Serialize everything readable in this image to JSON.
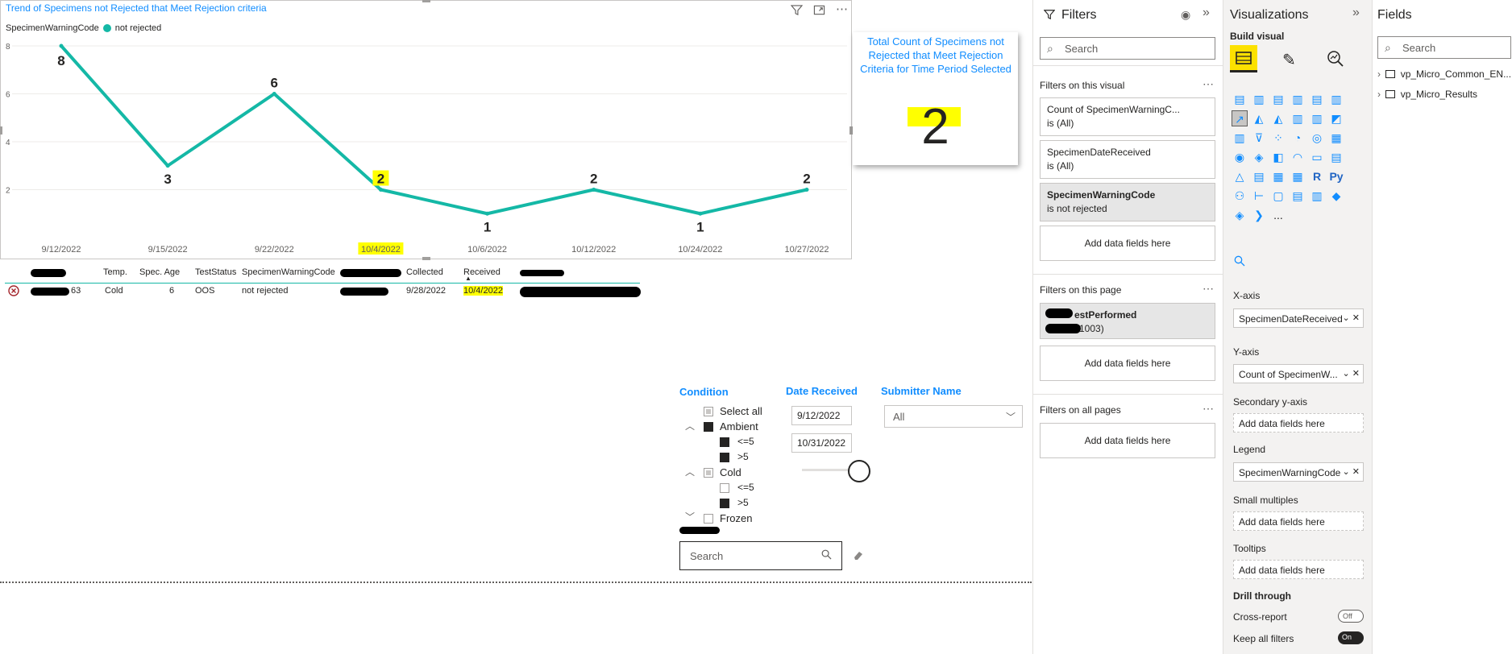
{
  "chart": {
    "title": "Trend of Specimens not Rejected that Meet Rejection criteria",
    "legend_title": "SpecimenWarningCode",
    "legend_item": "not rejected",
    "line_color": "#14b8a6",
    "y_ticks": [
      "8",
      "6",
      "4",
      "2"
    ],
    "icons": [
      "filter-icon",
      "focus-mode-icon",
      "more-options-icon"
    ]
  },
  "chart_data": {
    "type": "line",
    "categories": [
      "9/12/2022",
      "9/15/2022",
      "9/22/2022",
      "10/4/2022",
      "10/6/2022",
      "10/12/2022",
      "10/24/2022",
      "10/27/2022"
    ],
    "series": [
      {
        "name": "not rejected",
        "values": [
          8,
          3,
          6,
          2,
          1,
          2,
          1,
          2
        ]
      }
    ],
    "title": "Trend of Specimens not Rejected that Meet Rejection criteria",
    "ylim": [
      0,
      8
    ],
    "highlighted_category": "10/4/2022",
    "legend": "top-left",
    "grid": true
  },
  "card": {
    "label": "Total Count of Specimens not Rejected that Meet Rejection Criteria for Time Period Selected",
    "value": "2"
  },
  "table": {
    "headers": {
      "temp": "Temp.",
      "spec_age": "Spec. Age",
      "test_status": "TestStatus",
      "warning": "SpecimenWarningCode",
      "collected": "Collected",
      "received": "Received"
    },
    "row": {
      "id_suffix": "63",
      "temp": "Cold",
      "spec_age": "6",
      "test_status": "OOS",
      "warning": "not rejected",
      "collected": "9/28/2022",
      "received": "10/4/2022"
    }
  },
  "slicers": {
    "condition": {
      "title": "Condition",
      "items": [
        "Select all",
        "Ambient",
        "<=5",
        ">5",
        "Cold",
        "<=5",
        ">5",
        "Frozen"
      ]
    },
    "date_received": {
      "title": "Date Received",
      "start": "9/12/2022",
      "end": "10/31/2022"
    },
    "submitter": {
      "title": "Submitter Name",
      "value": "All"
    },
    "search_placeholder": "Search"
  },
  "filters_pane": {
    "title": "Filters",
    "search_placeholder": "Search",
    "on_visual_label": "Filters on this visual",
    "visual_filters": [
      {
        "name": "Count of SpecimenWarningC...",
        "state": "is (All)"
      },
      {
        "name": "SpecimenDateReceived",
        "state": "is (All)"
      },
      {
        "name": "SpecimenWarningCode",
        "state": "is not rejected"
      }
    ],
    "add_fields": "Add data fields here",
    "on_page_label": "Filters on this page",
    "page_filter": {
      "name": "estPerformed",
      "state": "1003)"
    },
    "on_all_pages_label": "Filters on all pages"
  },
  "viz_pane": {
    "title": "Visualizations",
    "build_visual": "Build visual",
    "wells": {
      "x_axis": {
        "label": "X-axis",
        "value": "SpecimenDateReceived"
      },
      "y_axis": {
        "label": "Y-axis",
        "value": "Count of SpecimenW..."
      },
      "secondary_y": {
        "label": "Secondary y-axis",
        "value": "Add data fields here"
      },
      "legend": {
        "label": "Legend",
        "value": "SpecimenWarningCode"
      },
      "small_multiples": {
        "label": "Small multiples",
        "value": "Add data fields here"
      },
      "tooltips": {
        "label": "Tooltips",
        "value": "Add data fields here"
      }
    },
    "drill_through": "Drill through",
    "cross_report": {
      "label": "Cross-report",
      "state": "Off"
    },
    "keep_all_filters": {
      "label": "Keep all filters",
      "state": "On"
    },
    "r_label": "R",
    "py_label": "Py",
    "more_label": "..."
  },
  "fields_pane": {
    "title": "Fields",
    "search_placeholder": "Search",
    "tables": [
      "vp_Micro_Common_EN...",
      "vp_Micro_Results"
    ]
  }
}
